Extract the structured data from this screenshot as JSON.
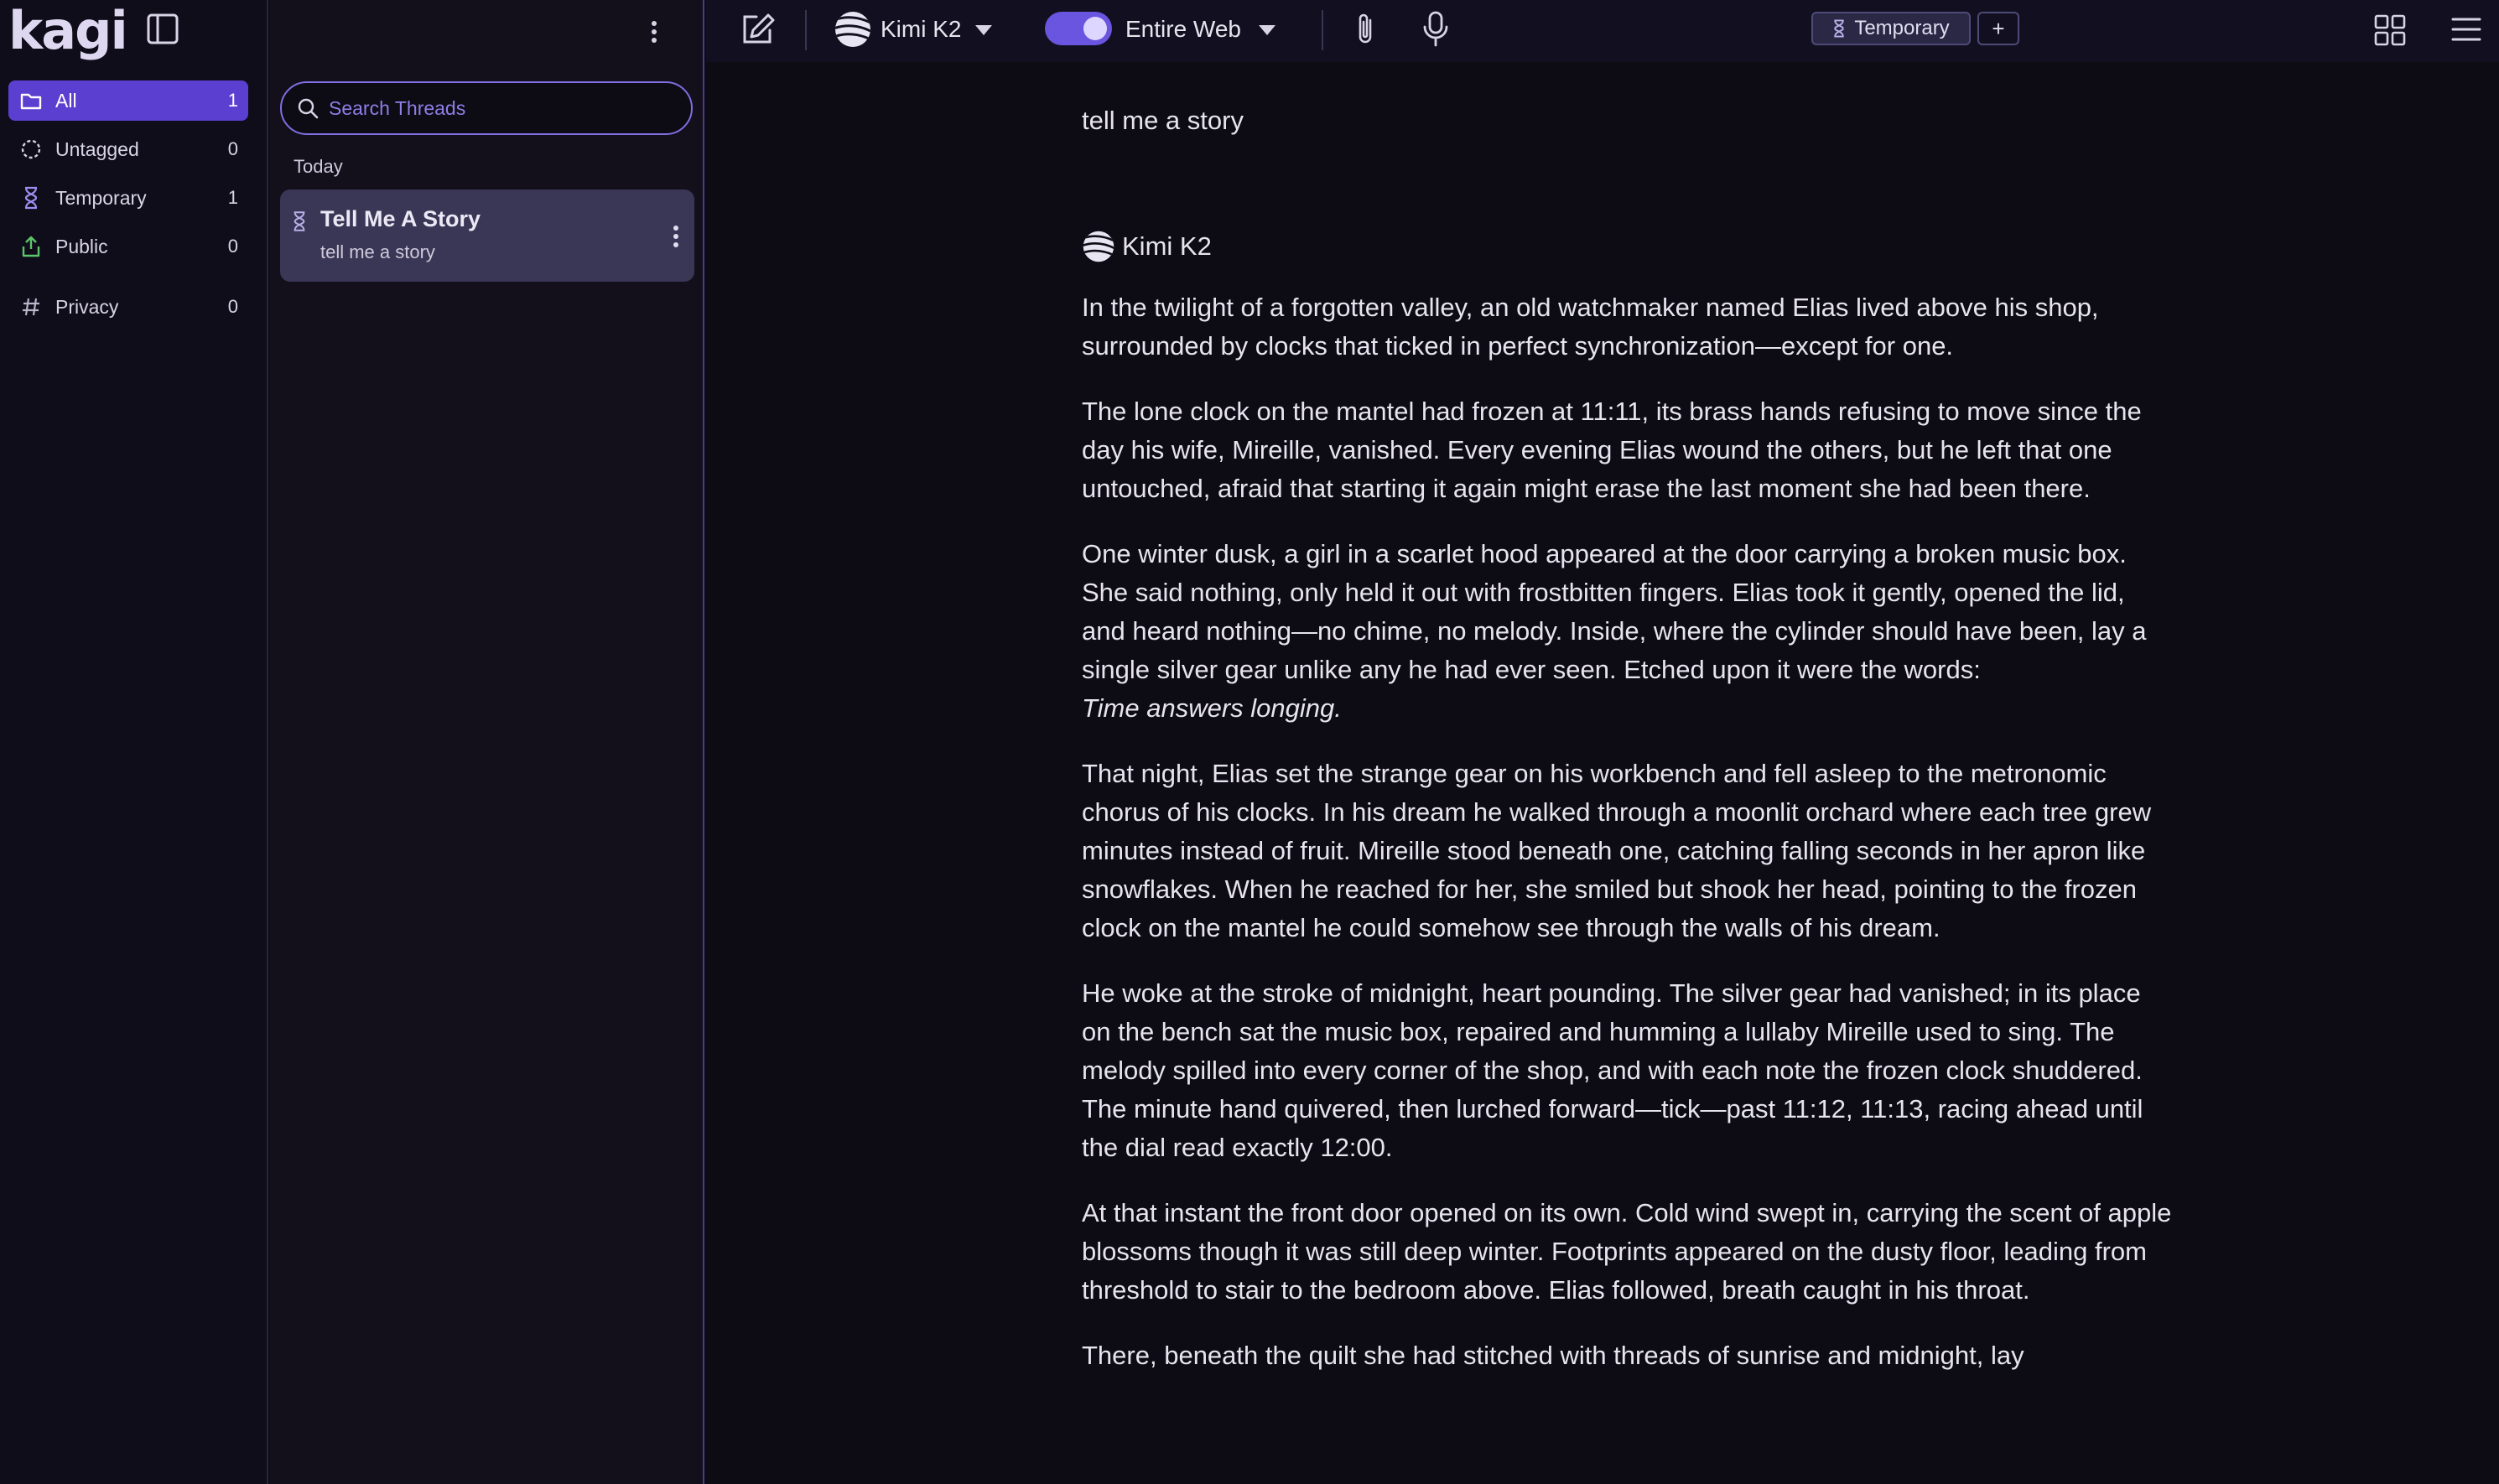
{
  "app": {
    "logo": "kagi"
  },
  "sidebar": {
    "tags": [
      {
        "label": "All",
        "count": "1",
        "icon": "folder-icon",
        "active": true
      },
      {
        "label": "Untagged",
        "count": "0",
        "icon": "dashed-circle-icon"
      },
      {
        "label": "Temporary",
        "count": "1",
        "icon": "hourglass-icon"
      },
      {
        "label": "Public",
        "count": "0",
        "icon": "share-icon"
      },
      {
        "label": "Privacy",
        "count": "0",
        "icon": "hash-icon"
      }
    ]
  },
  "threads": {
    "search": {
      "placeholder": "Search Threads"
    },
    "section_title": "Today",
    "items": [
      {
        "title": "Tell Me A Story",
        "subtitle": "tell me a story",
        "icon": "hourglass-icon"
      }
    ]
  },
  "toolbar": {
    "model": "Kimi K2",
    "web_toggle_on": true,
    "scope": "Entire Web",
    "temporary_label": "Temporary",
    "plus_label": "+"
  },
  "conversation": {
    "user_message": "tell me a story",
    "assistant_model": "Kimi K2",
    "paragraphs": [
      "In the twilight of a forgotten valley, an old watchmaker named Elias lived above his shop, surrounded by clocks that ticked in perfect synchronization—except for one.",
      "The lone clock on the mantel had frozen at 11:11, its brass hands refusing to move since the day his wife, Mireille, vanished. Every evening Elias wound the others, but he left that one untouched, afraid that starting it again might erase the last moment she had been there.",
      "One winter dusk, a girl in a scarlet hood appeared at the door carrying a broken music box. She said nothing, only held it out with frostbitten fingers. Elias took it gently, opened the lid, and heard nothing—no chime, no melody. Inside, where the cylinder should have been, lay a single silver gear unlike any he had ever seen. Etched upon it were the words:",
      "That night, Elias set the strange gear on his workbench and fell asleep to the metronomic chorus of his clocks. In his dream he walked through a moonlit orchard where each tree grew minutes instead of fruit. Mireille stood beneath one, catching falling seconds in her apron like snowflakes. When he reached for her, she smiled but shook her head, pointing to the frozen clock on the mantel he could somehow see through the walls of his dream.",
      "He woke at the stroke of midnight, heart pounding. The silver gear had vanished; in its place on the bench sat the music box, repaired and humming a lullaby Mireille used to sing. The melody spilled into every corner of the shop, and with each note the frozen clock shuddered. The minute hand quivered, then lurched forward—tick—past 11:12, 11:13, racing ahead until the dial read exactly 12:00.",
      "At that instant the front door opened on its own. Cold wind swept in, carrying the scent of apple blossoms though it was still deep winter. Footprints appeared on the dusty floor, leading from threshold to stair to the bedroom above. Elias followed, breath caught in his throat.",
      "There, beneath the quilt she had stitched with threads of sunrise and midnight, lay"
    ],
    "engraving": "Time answers longing."
  }
}
